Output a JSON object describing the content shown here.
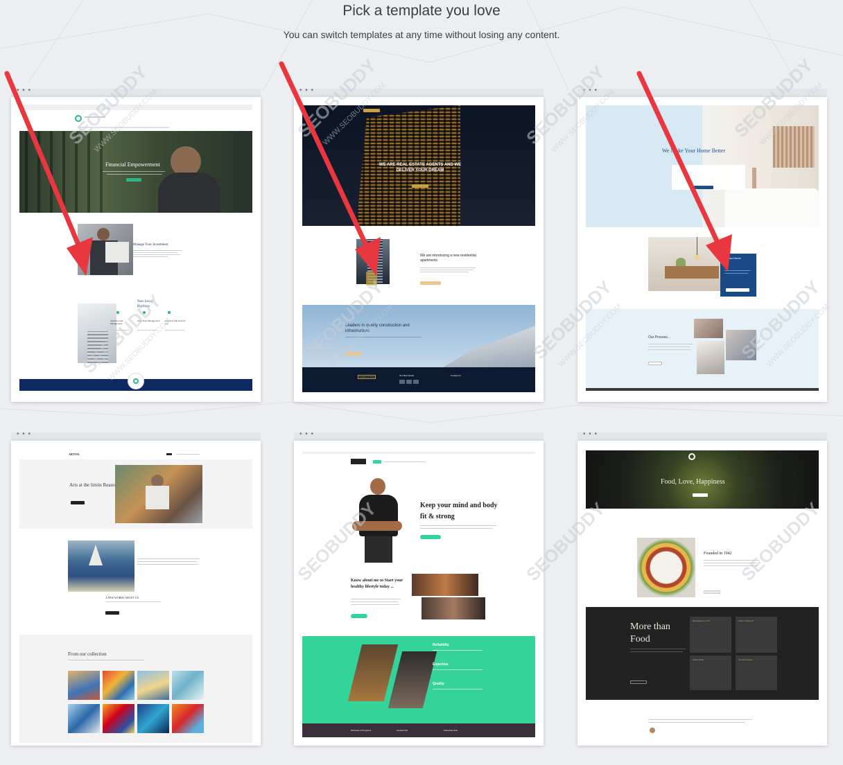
{
  "header": {
    "title": "Pick a template you love",
    "subtitle": "You can switch templates at any time without losing any content."
  },
  "colors": {
    "page_bg": "#eceef1",
    "arrow": "#e8373f",
    "watermark": "#c8ccd2"
  },
  "watermark": {
    "brand": "SEOBUDDY",
    "url": "WWW.SEOBUDDY.COM"
  },
  "window_dots": "• • •",
  "templates": [
    {
      "name": "finance",
      "hero_title": "Financial Empowerment",
      "section1_title": "Manage Your Investment",
      "section2_title": "New Level Business",
      "features": [
        "Solutions and Management",
        "Cash Flow Management",
        "Solutions that work for you"
      ]
    },
    {
      "name": "real-estate",
      "hero_title": "WE ARE REAL ESTATE AGENTS AND WE DELIVER YOUR DREAM",
      "section1_title": "We are introducing a new residential apartments",
      "section2_title": "Leaders in quality construction and infrastructure",
      "footer_logo": "SUBDE ESTATE",
      "footer_col1": "Our Best Works",
      "footer_col2": "Contact Us"
    },
    {
      "name": "home",
      "hero_title": "We Make Your Home Better",
      "card_title": "Dream Home",
      "section2_title": "Our Process..."
    },
    {
      "name": "art",
      "logo": "ARTING",
      "hero_title": "Arts at the limits Reason",
      "section1_title": "A FEW WORDS ABOUT US",
      "section2_title": "From our collection"
    },
    {
      "name": "fitness",
      "hero_title": "Keep your mind and body fit & strong",
      "section1_title": "Know about me to Start your healthy lifestyle today ...",
      "features": [
        "Reliability",
        "Expertise",
        "Quality"
      ],
      "footer": [
        "Workouts & Programs",
        "Contact Info",
        "Subscribe Now"
      ]
    },
    {
      "name": "restaurant",
      "hero_title": "Food, Love, Happiness",
      "section1_title": "Founded in 1942",
      "section2_title": "More than Food",
      "menu": [
        "Breakfast & Lunch",
        "Dinner & Brunch",
        "Pasta Salad",
        "Tea and Cakes"
      ]
    }
  ]
}
